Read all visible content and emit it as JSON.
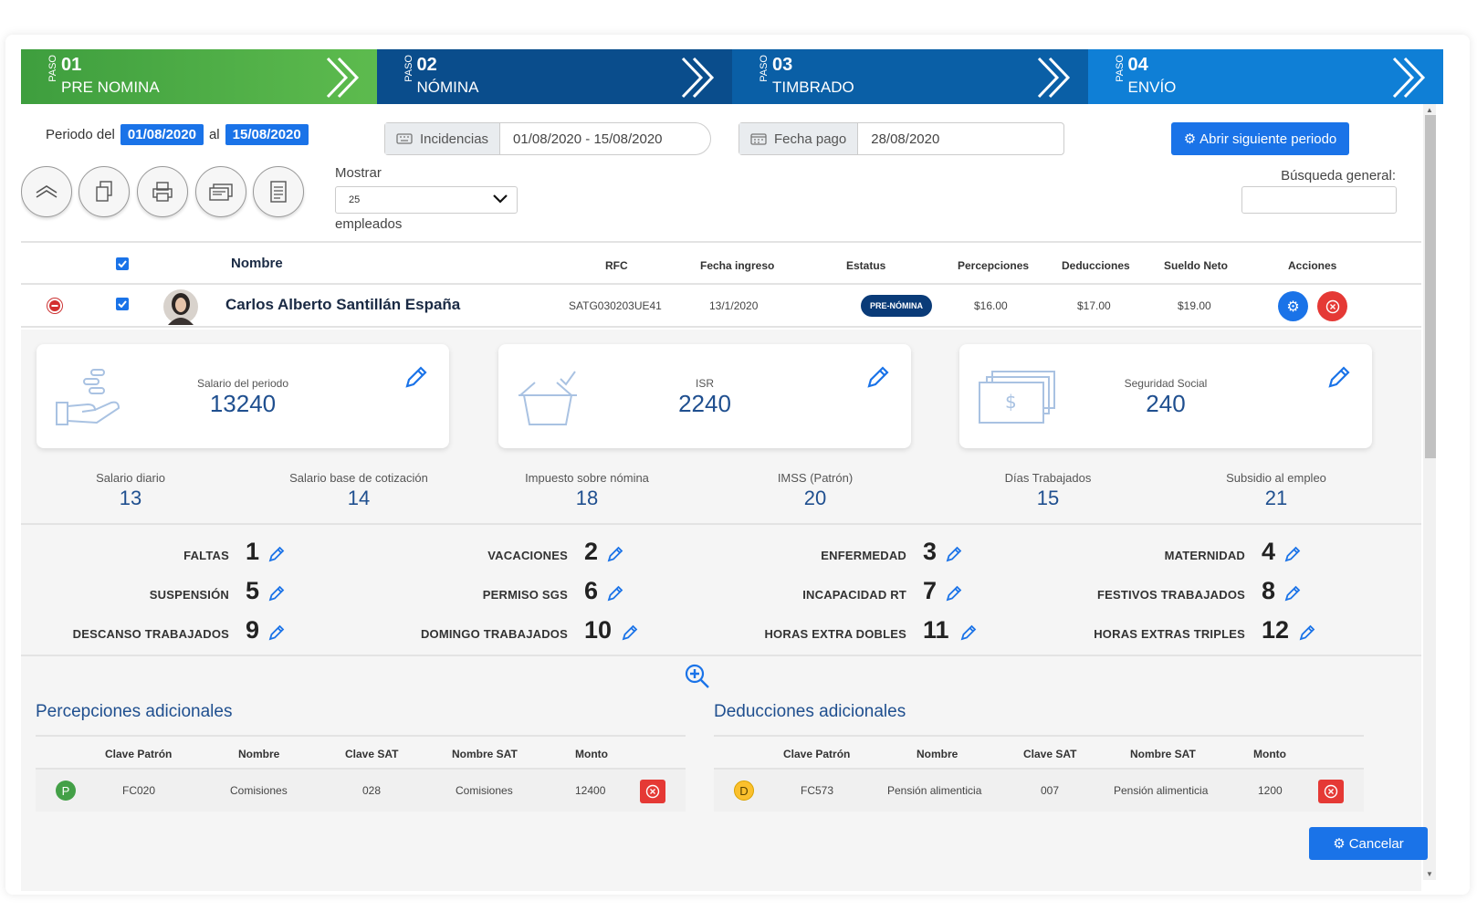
{
  "colors": {
    "primary": "#1a73e8",
    "danger": "#e53935",
    "step1": "#4caf50",
    "step2": "#0a4d8c",
    "step3": "#0a5fa6",
    "step4": "#0f7fd6",
    "accent_text": "#1f4f8f"
  },
  "steps": [
    {
      "paso": "PASO",
      "num": "01",
      "label": "PRE NOMINA"
    },
    {
      "paso": "PASO",
      "num": "02",
      "label": "NÓMINA"
    },
    {
      "paso": "PASO",
      "num": "03",
      "label": "TIMBRADO"
    },
    {
      "paso": "PASO",
      "num": "04",
      "label": "ENVÍO"
    }
  ],
  "periodo": {
    "label_del": "Periodo del",
    "start": "01/08/2020",
    "label_al": "al",
    "end": "15/08/2020"
  },
  "incidencias": {
    "label": "Incidencias",
    "value": "01/08/2020 - 15/08/2020",
    "icon": "keyboard-icon"
  },
  "fecha_pago": {
    "label": "Fecha pago",
    "value": "28/08/2020",
    "icon": "calendar-icon"
  },
  "abrir_button": "Abrir siguiente periodo",
  "cancel_button": "Cancelar",
  "mostrar": {
    "label": "Mostrar",
    "selected": "25",
    "suffix": "empleados"
  },
  "busqueda": {
    "label": "Búsqueda general:",
    "value": ""
  },
  "toolbar_icons": [
    "collapse-up-icon",
    "copy-icon",
    "print-icon",
    "cards-icon",
    "document-icon"
  ],
  "table": {
    "headers": {
      "nombre": "Nombre",
      "rfc": "RFC",
      "fecha": "Fecha ingreso",
      "estatus": "Estatus",
      "percepciones": "Percepciones",
      "deducciones": "Deducciones",
      "sueldo": "Sueldo Neto",
      "acciones": "Acciones"
    },
    "row": {
      "nombre": "Carlos Alberto Santillán España",
      "rfc": "SATG030203UE41",
      "fecha": "13/1/2020",
      "estatus": "PRE-NÓMINA",
      "percepciones": "$16.00",
      "deducciones": "$17.00",
      "sueldo": "$19.00"
    }
  },
  "cards": [
    {
      "label": "Salario del periodo",
      "value": "13240",
      "icon": "hand-coins-icon"
    },
    {
      "label": "ISR",
      "value": "2240",
      "icon": "basket-check-icon"
    },
    {
      "label": "Seguridad Social",
      "value": "240",
      "icon": "money-stack-icon"
    }
  ],
  "stats": [
    {
      "label": "Salario diario",
      "value": "13"
    },
    {
      "label": "Salario base de cotización",
      "value": "14"
    },
    {
      "label": "Impuesto sobre nómina",
      "value": "18"
    },
    {
      "label": "IMSS (Patrón)",
      "value": "20"
    },
    {
      "label": "Días Trabajados",
      "value": "15"
    },
    {
      "label": "Subsidio al empleo",
      "value": "21"
    }
  ],
  "incidencias_grid": [
    {
      "label": "FALTAS",
      "value": "1"
    },
    {
      "label": "VACACIONES",
      "value": "2"
    },
    {
      "label": "ENFERMEDAD",
      "value": "3"
    },
    {
      "label": "MATERNIDAD",
      "value": "4"
    },
    {
      "label": "SUSPENSIÓN",
      "value": "5"
    },
    {
      "label": "PERMISO SGS",
      "value": "6"
    },
    {
      "label": "INCAPACIDAD RT",
      "value": "7"
    },
    {
      "label": "FESTIVOS TRABAJADOS",
      "value": "8"
    },
    {
      "label": "DESCANSO TRABAJADOS",
      "value": "9"
    },
    {
      "label": "DOMINGO TRABAJADOS",
      "value": "10"
    },
    {
      "label": "HORAS EXTRA DOBLES",
      "value": "11"
    },
    {
      "label": "HORAS EXTRAS TRIPLES",
      "value": "12"
    }
  ],
  "percepciones": {
    "title": "Percepciones adicionales",
    "headers": [
      "Clave Patrón",
      "Nombre",
      "Clave SAT",
      "Nombre SAT",
      "Monto"
    ],
    "row": {
      "tag": "P",
      "clave": "FC020",
      "nombre": "Comisiones",
      "clave_sat": "028",
      "nombre_sat": "Comisiones",
      "monto": "12400"
    }
  },
  "deducciones": {
    "title": "Deducciones adicionales",
    "headers": [
      "Clave Patrón",
      "Nombre",
      "Clave SAT",
      "Nombre SAT",
      "Monto"
    ],
    "row": {
      "tag": "D",
      "clave": "FC573",
      "nombre": "Pensión alimenticia",
      "clave_sat": "007",
      "nombre_sat": "Pensión alimenticia",
      "monto": "1200"
    }
  }
}
